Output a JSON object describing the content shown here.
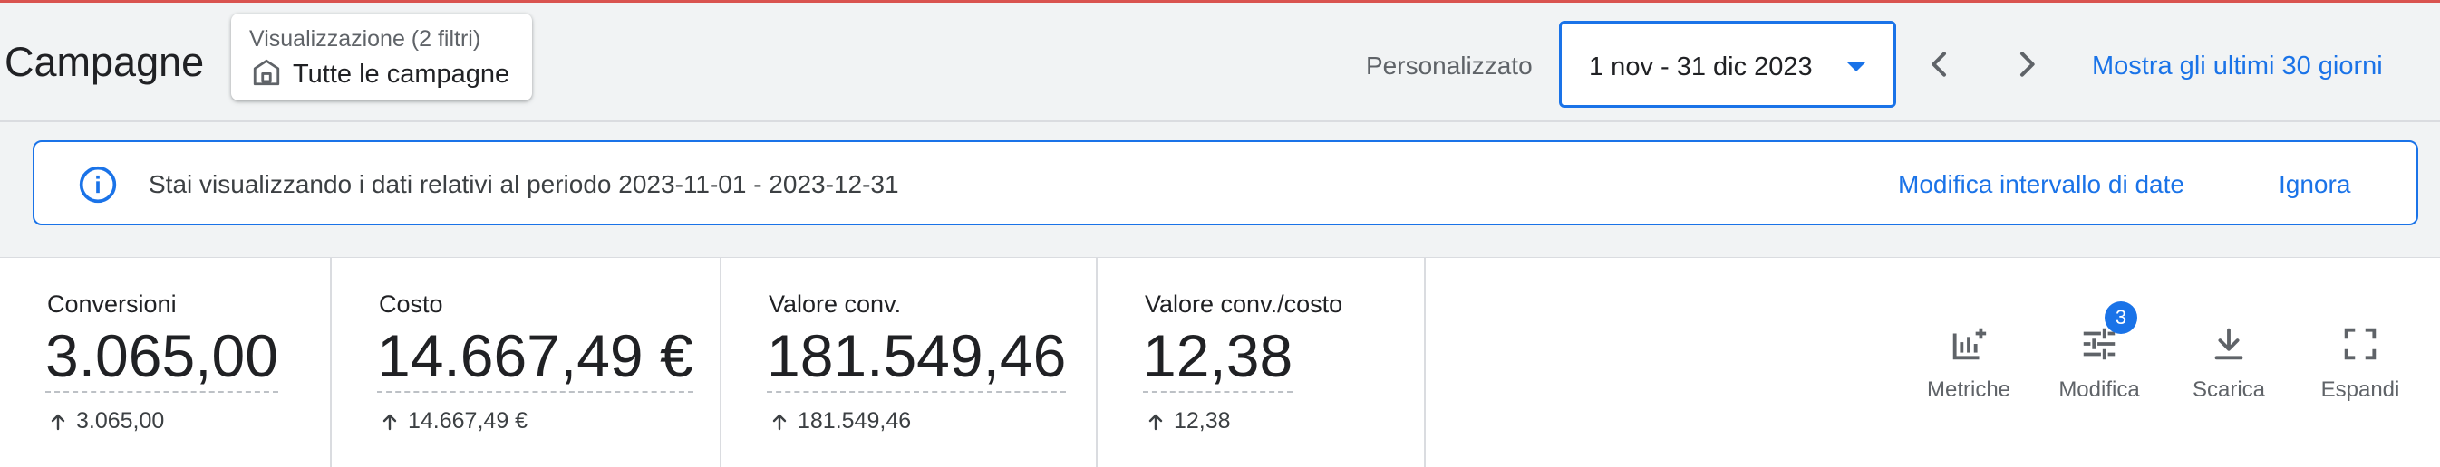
{
  "header": {
    "title": "Campagne",
    "view_selector": {
      "subtitle": "Visualizzazione (2 filtri)",
      "label": "Tutte le campagne"
    },
    "date_range": {
      "mode_label": "Personalizzato",
      "value": "1 nov - 31 dic 2023",
      "show_last_30_label": "Mostra gli ultimi 30 giorni"
    }
  },
  "banner": {
    "text": "Stai visualizzando i dati relativi al periodo 2023-11-01 - 2023-12-31",
    "edit_link": "Modifica intervallo di date",
    "dismiss_link": "Ignora"
  },
  "scorecards": [
    {
      "label": "Conversioni",
      "value": "3.065,00",
      "delta": "3.065,00"
    },
    {
      "label": "Costo",
      "value": "14.667,49 €",
      "delta": "14.667,49 €"
    },
    {
      "label": "Valore conv.",
      "value": "181.549,46",
      "delta": "181.549,46"
    },
    {
      "label": "Valore conv./costo",
      "value": "12,38",
      "delta": "12,38"
    }
  ],
  "toolbar": {
    "metrics_label": "Metriche",
    "modify_label": "Modifica",
    "modify_badge": "3",
    "download_label": "Scarica",
    "expand_label": "Espandi"
  },
  "colors": {
    "accent": "#1a73e8",
    "text": "#202124",
    "muted": "#5f6368",
    "border": "#dadce0",
    "top_rule": "#d9534f"
  },
  "icons": [
    "home-icon",
    "chevron-down-icon",
    "chevron-left-icon",
    "chevron-right-icon",
    "info-icon",
    "arrow-up-icon",
    "metrics-chart-icon",
    "tune-icon",
    "download-icon",
    "fullscreen-icon"
  ]
}
